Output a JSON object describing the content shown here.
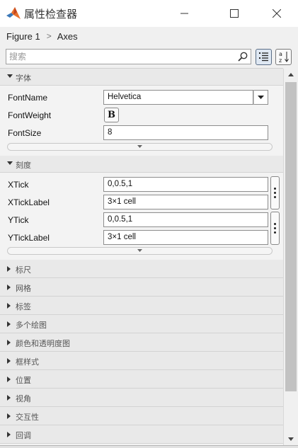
{
  "window": {
    "title": "属性检查器",
    "icons": {
      "app": "matlab-logo-icon",
      "minimize": "minimize-icon",
      "maximize": "maximize-icon",
      "close": "close-icon"
    }
  },
  "breadcrumb": {
    "root": "Figure 1",
    "separator": ">",
    "current": "Axes"
  },
  "search": {
    "placeholder": "搜索",
    "value": ""
  },
  "toolbar": {
    "categorized": "categorized-view-icon",
    "sort": "alphabetical-sort-icon",
    "sort_glyph_top": "a",
    "sort_glyph_bottom": "z"
  },
  "groups": {
    "font": {
      "label": "字体",
      "expanded": true,
      "props": {
        "fontname_label": "FontName",
        "fontname_value": "Helvetica",
        "fontweight_label": "FontWeight",
        "fontweight_glyph": "B",
        "fontsize_label": "FontSize",
        "fontsize_value": "8"
      }
    },
    "ticks": {
      "label": "刻度",
      "expanded": true,
      "props": {
        "xtick_label": "XTick",
        "xtick_value": "0,0.5,1",
        "xticklabel_label": "XTickLabel",
        "xticklabel_value": "3×1 cell",
        "ytick_label": "YTick",
        "ytick_value": "0,0.5,1",
        "yticklabel_label": "YTickLabel",
        "yticklabel_value": "3×1 cell"
      }
    },
    "collapsed": [
      {
        "label": "标尺"
      },
      {
        "label": "网格"
      },
      {
        "label": "标签"
      },
      {
        "label": "多个绘图"
      },
      {
        "label": "颜色和透明度图"
      },
      {
        "label": "框样式"
      },
      {
        "label": "位置"
      },
      {
        "label": "视角"
      },
      {
        "label": "交互性"
      },
      {
        "label": "回调"
      }
    ]
  },
  "scrollbar": {
    "position_fraction": 0.0,
    "visible_fraction": 0.86
  }
}
